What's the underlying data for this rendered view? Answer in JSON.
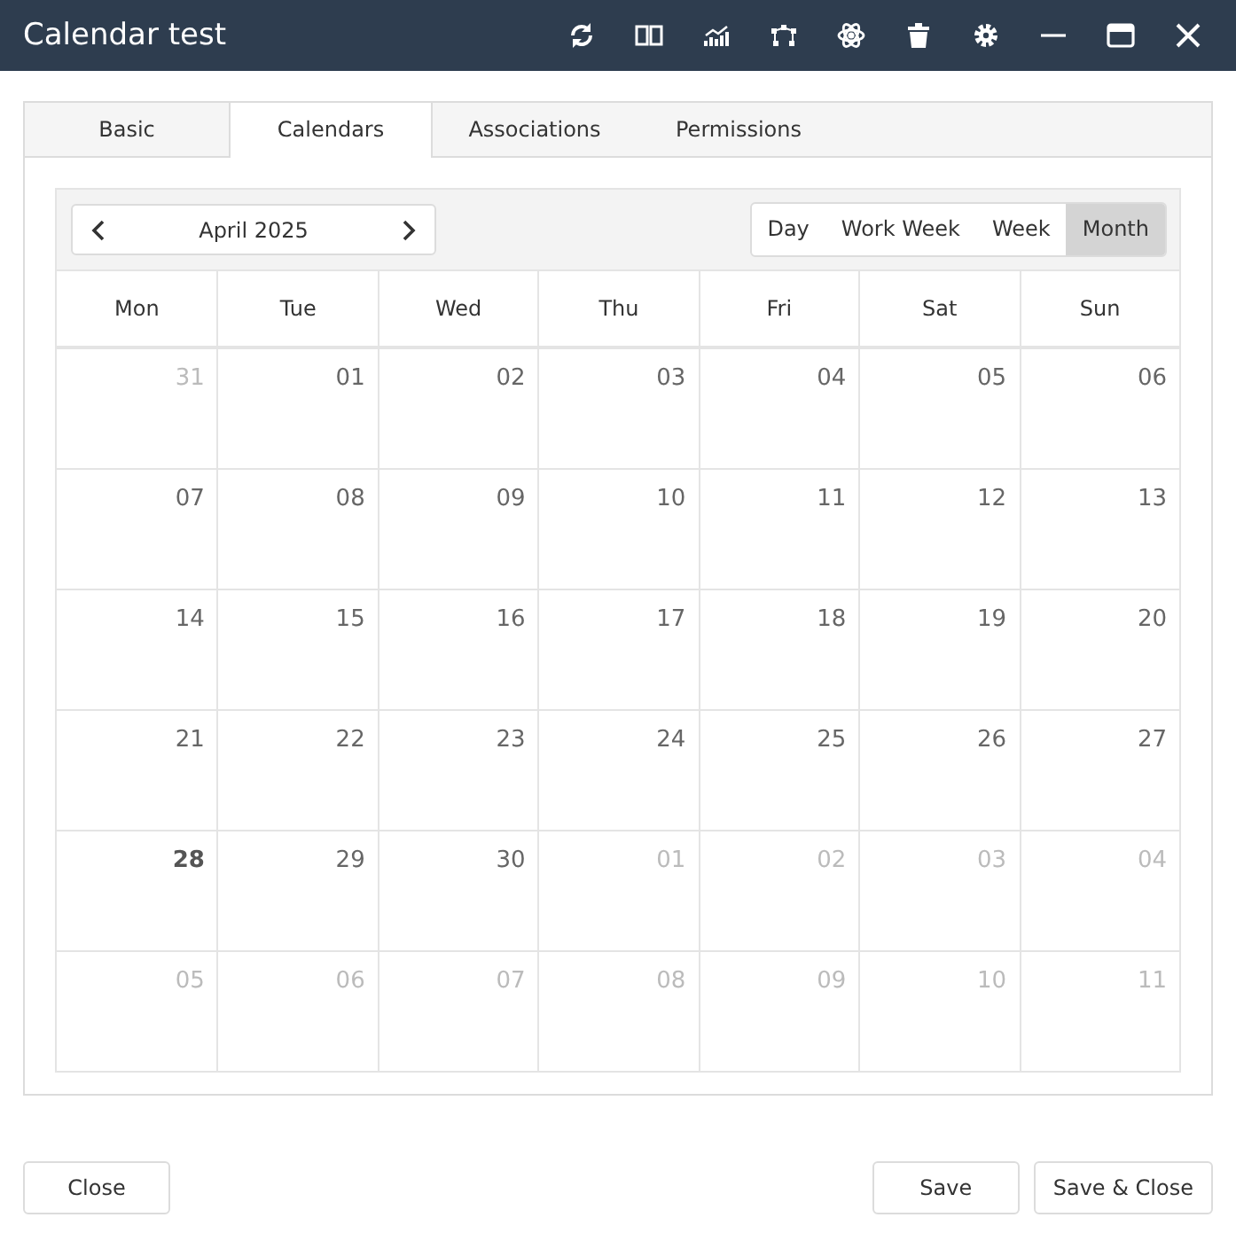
{
  "window": {
    "title": "Calendar test"
  },
  "tabs": [
    {
      "label": "Basic",
      "selected": false
    },
    {
      "label": "Calendars",
      "selected": true
    },
    {
      "label": "Associations",
      "selected": false
    },
    {
      "label": "Permissions",
      "selected": false
    }
  ],
  "calendar": {
    "period": "April 2025",
    "views": [
      {
        "label": "Day",
        "selected": false
      },
      {
        "label": "Work Week",
        "selected": false
      },
      {
        "label": "Week",
        "selected": false
      },
      {
        "label": "Month",
        "selected": true
      }
    ],
    "weekdays": [
      "Mon",
      "Tue",
      "Wed",
      "Thu",
      "Fri",
      "Sat",
      "Sun"
    ],
    "weeks": [
      [
        {
          "label": "31",
          "in_month": false,
          "today": false
        },
        {
          "label": "01",
          "in_month": true,
          "today": false
        },
        {
          "label": "02",
          "in_month": true,
          "today": false
        },
        {
          "label": "03",
          "in_month": true,
          "today": false
        },
        {
          "label": "04",
          "in_month": true,
          "today": false
        },
        {
          "label": "05",
          "in_month": true,
          "today": false
        },
        {
          "label": "06",
          "in_month": true,
          "today": false
        }
      ],
      [
        {
          "label": "07",
          "in_month": true,
          "today": false
        },
        {
          "label": "08",
          "in_month": true,
          "today": false
        },
        {
          "label": "09",
          "in_month": true,
          "today": false
        },
        {
          "label": "10",
          "in_month": true,
          "today": false
        },
        {
          "label": "11",
          "in_month": true,
          "today": false
        },
        {
          "label": "12",
          "in_month": true,
          "today": false
        },
        {
          "label": "13",
          "in_month": true,
          "today": false
        }
      ],
      [
        {
          "label": "14",
          "in_month": true,
          "today": false
        },
        {
          "label": "15",
          "in_month": true,
          "today": false
        },
        {
          "label": "16",
          "in_month": true,
          "today": false
        },
        {
          "label": "17",
          "in_month": true,
          "today": false
        },
        {
          "label": "18",
          "in_month": true,
          "today": false
        },
        {
          "label": "19",
          "in_month": true,
          "today": false
        },
        {
          "label": "20",
          "in_month": true,
          "today": false
        }
      ],
      [
        {
          "label": "21",
          "in_month": true,
          "today": false
        },
        {
          "label": "22",
          "in_month": true,
          "today": false
        },
        {
          "label": "23",
          "in_month": true,
          "today": false
        },
        {
          "label": "24",
          "in_month": true,
          "today": false
        },
        {
          "label": "25",
          "in_month": true,
          "today": false
        },
        {
          "label": "26",
          "in_month": true,
          "today": false
        },
        {
          "label": "27",
          "in_month": true,
          "today": false
        }
      ],
      [
        {
          "label": "28",
          "in_month": true,
          "today": true
        },
        {
          "label": "29",
          "in_month": true,
          "today": false
        },
        {
          "label": "30",
          "in_month": true,
          "today": false
        },
        {
          "label": "01",
          "in_month": false,
          "today": false
        },
        {
          "label": "02",
          "in_month": false,
          "today": false
        },
        {
          "label": "03",
          "in_month": false,
          "today": false
        },
        {
          "label": "04",
          "in_month": false,
          "today": false
        }
      ],
      [
        {
          "label": "05",
          "in_month": false,
          "today": false
        },
        {
          "label": "06",
          "in_month": false,
          "today": false
        },
        {
          "label": "07",
          "in_month": false,
          "today": false
        },
        {
          "label": "08",
          "in_month": false,
          "today": false
        },
        {
          "label": "09",
          "in_month": false,
          "today": false
        },
        {
          "label": "10",
          "in_month": false,
          "today": false
        },
        {
          "label": "11",
          "in_month": false,
          "today": false
        }
      ]
    ]
  },
  "footer": {
    "left_buttons": [
      "Close"
    ],
    "right_buttons": [
      "Save",
      "Save & Close"
    ]
  }
}
